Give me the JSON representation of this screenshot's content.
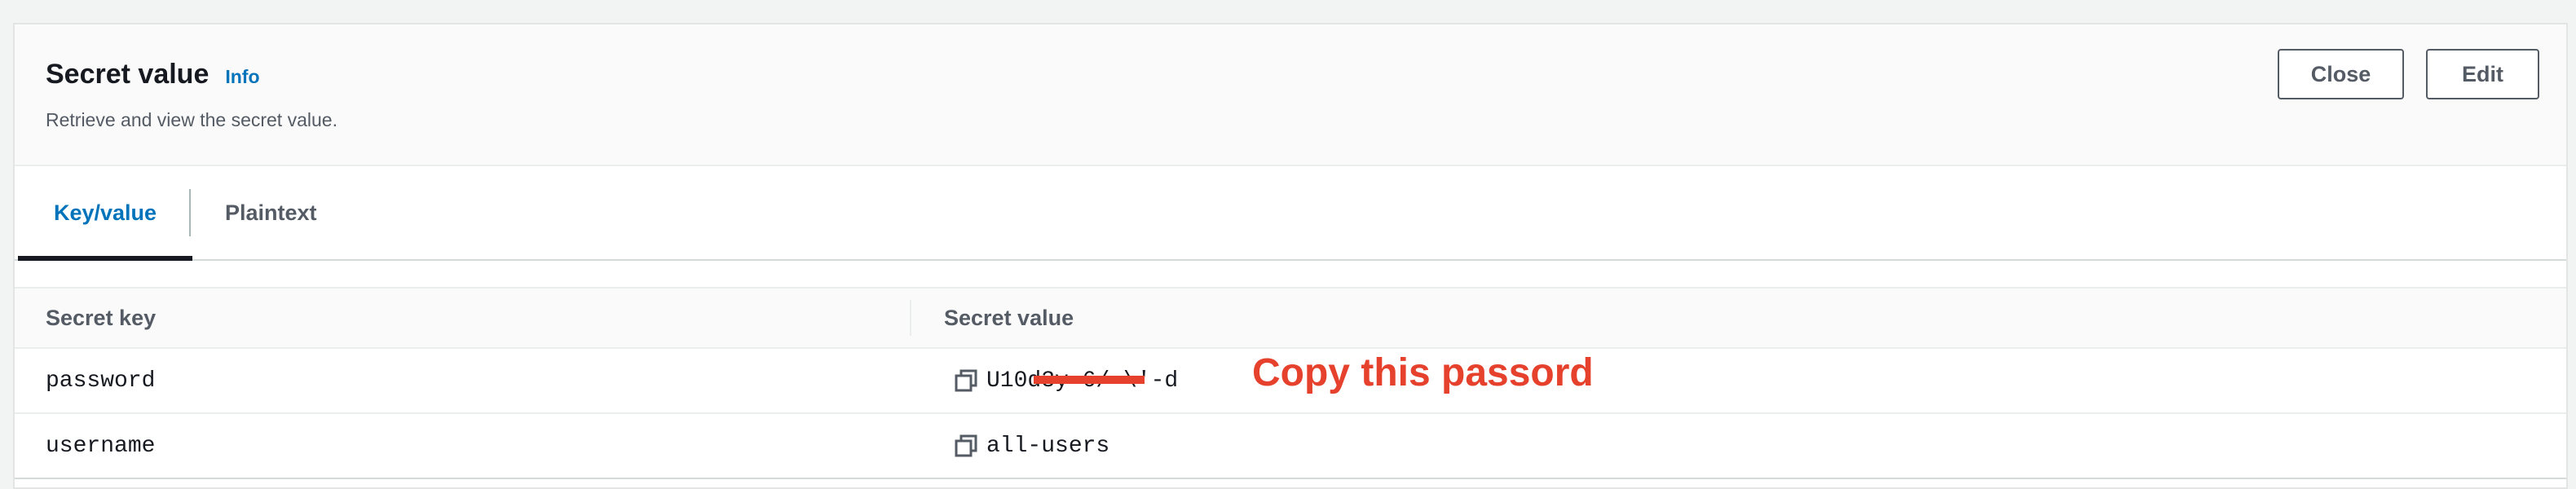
{
  "header": {
    "title": "Secret value",
    "info_link": "Info",
    "description": "Retrieve and view the secret value.",
    "close_label": "Close",
    "edit_label": "Edit"
  },
  "tabs": [
    {
      "label": "Key/value",
      "active": true
    },
    {
      "label": "Plaintext",
      "active": false
    }
  ],
  "table": {
    "columns": [
      "Secret key",
      "Secret value"
    ],
    "rows": [
      {
        "key": "password",
        "value": "U10d3y-6/-\\'-d"
      },
      {
        "key": "username",
        "value": "all-users"
      }
    ]
  },
  "annotation": {
    "text": "Copy this passord",
    "color": "#e5412d"
  },
  "colors": {
    "accent": "#0073bb",
    "text": "#16191f",
    "muted": "#545b64"
  },
  "icons": {
    "copy": "copy-icon"
  }
}
